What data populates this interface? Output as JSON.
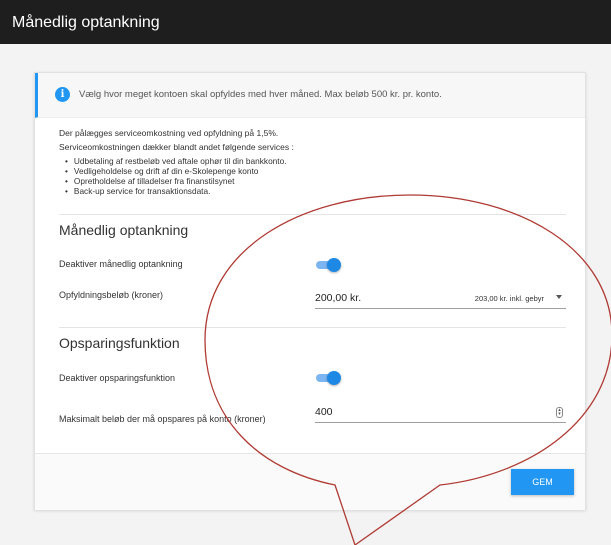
{
  "window": {
    "title": "Månedlig optankning"
  },
  "info": {
    "text": "Vælg hvor meget kontoen skal opfyldes med hver måned. Max beløb 500 kr. pr. konto.",
    "icon": "info-icon"
  },
  "description": {
    "line1": "Der pålægges serviceomkostning ved opfyldning på 1,5%.",
    "line2": "Serviceomkostningen dækker blandt andet følgende services :",
    "bullets": [
      "Udbetaling af restbeløb ved aftale ophør til din bankkonto.",
      "Vedligeholdelse og drift af din e-Skolepenge konto",
      "Opretholdelse af tilladelser fra finanstilsynet",
      "Back-up service for transaktionsdata."
    ]
  },
  "monthly": {
    "title": "Månedlig optankning",
    "deactivate_label": "Deaktiver månedlig optankning",
    "amount_label": "Opfyldningsbeløb (kroner)",
    "amount_value": "200,00 kr.",
    "amount_note": "203,00 kr. inkl. gebyr"
  },
  "savings": {
    "title": "Opsparingsfunktion",
    "deactivate_label": "Deaktiver opsparingsfunktion",
    "max_label": "Maksimalt beløb der må opspares på konto (kroner)",
    "max_value": "400"
  },
  "actions": {
    "save_label": "GEM"
  },
  "colors": {
    "accent": "#2196f3",
    "callout": "#b03a34",
    "titlebar": "#1e1e1e"
  }
}
